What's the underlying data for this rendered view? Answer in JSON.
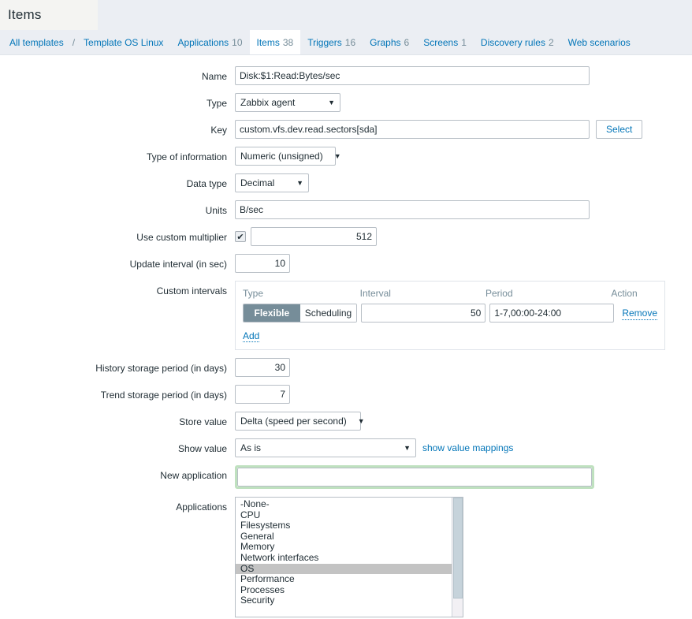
{
  "header": {
    "title": "Items"
  },
  "breadcrumb": [
    {
      "label": "All templates",
      "count": "",
      "active": false
    },
    {
      "label": "Template OS Linux",
      "count": "",
      "active": false
    },
    {
      "label": "Applications",
      "count": "10",
      "active": false
    },
    {
      "label": "Items",
      "count": "38",
      "active": true
    },
    {
      "label": "Triggers",
      "count": "16",
      "active": false
    },
    {
      "label": "Graphs",
      "count": "6",
      "active": false
    },
    {
      "label": "Screens",
      "count": "1",
      "active": false
    },
    {
      "label": "Discovery rules",
      "count": "2",
      "active": false
    },
    {
      "label": "Web scenarios",
      "count": "",
      "active": false
    }
  ],
  "separator": "/",
  "form": {
    "name": {
      "label": "Name",
      "value": "Disk:$1:Read:Bytes/sec"
    },
    "type": {
      "label": "Type",
      "value": "Zabbix agent"
    },
    "key": {
      "label": "Key",
      "value": "custom.vfs.dev.read.sectors[sda]",
      "button": "Select"
    },
    "type_of_information": {
      "label": "Type of information",
      "value": "Numeric (unsigned)"
    },
    "data_type": {
      "label": "Data type",
      "value": "Decimal"
    },
    "units": {
      "label": "Units",
      "value": "B/sec"
    },
    "custom_multiplier": {
      "label": "Use custom multiplier",
      "checked": true,
      "check_glyph": "✔",
      "value": "512"
    },
    "update_interval": {
      "label": "Update interval (in sec)",
      "value": "10"
    },
    "custom_intervals": {
      "label": "Custom intervals",
      "headers": [
        "Type",
        "Interval",
        "Period",
        "Action"
      ],
      "rows": [
        {
          "type_flexible": "Flexible",
          "type_scheduling": "Scheduling",
          "selected_type": "Flexible",
          "interval": "50",
          "period": "1-7,00:00-24:00",
          "action": "Remove"
        }
      ],
      "add_label": "Add"
    },
    "history_storage": {
      "label": "History storage period (in days)",
      "value": "30"
    },
    "trend_storage": {
      "label": "Trend storage period (in days)",
      "value": "7"
    },
    "store_value": {
      "label": "Store value",
      "value": "Delta (speed per second)"
    },
    "show_value": {
      "label": "Show value",
      "value": "As is",
      "link": "show value mappings"
    },
    "new_application": {
      "label": "New application",
      "value": "",
      "placeholder": ""
    },
    "applications": {
      "label": "Applications",
      "options": [
        "-None-",
        "CPU",
        "Filesystems",
        "General",
        "Memory",
        "Network interfaces",
        "OS",
        "Performance",
        "Processes",
        "Security"
      ],
      "selected": "OS"
    }
  },
  "icons": {
    "caret_down": "▼"
  },
  "colors": {
    "link": "#0275b8",
    "header_bg": "#ebeef3",
    "toggle_active": "#768d99",
    "highlight_border": "#bfe1bf",
    "list_selection": "#c3c3c3"
  }
}
